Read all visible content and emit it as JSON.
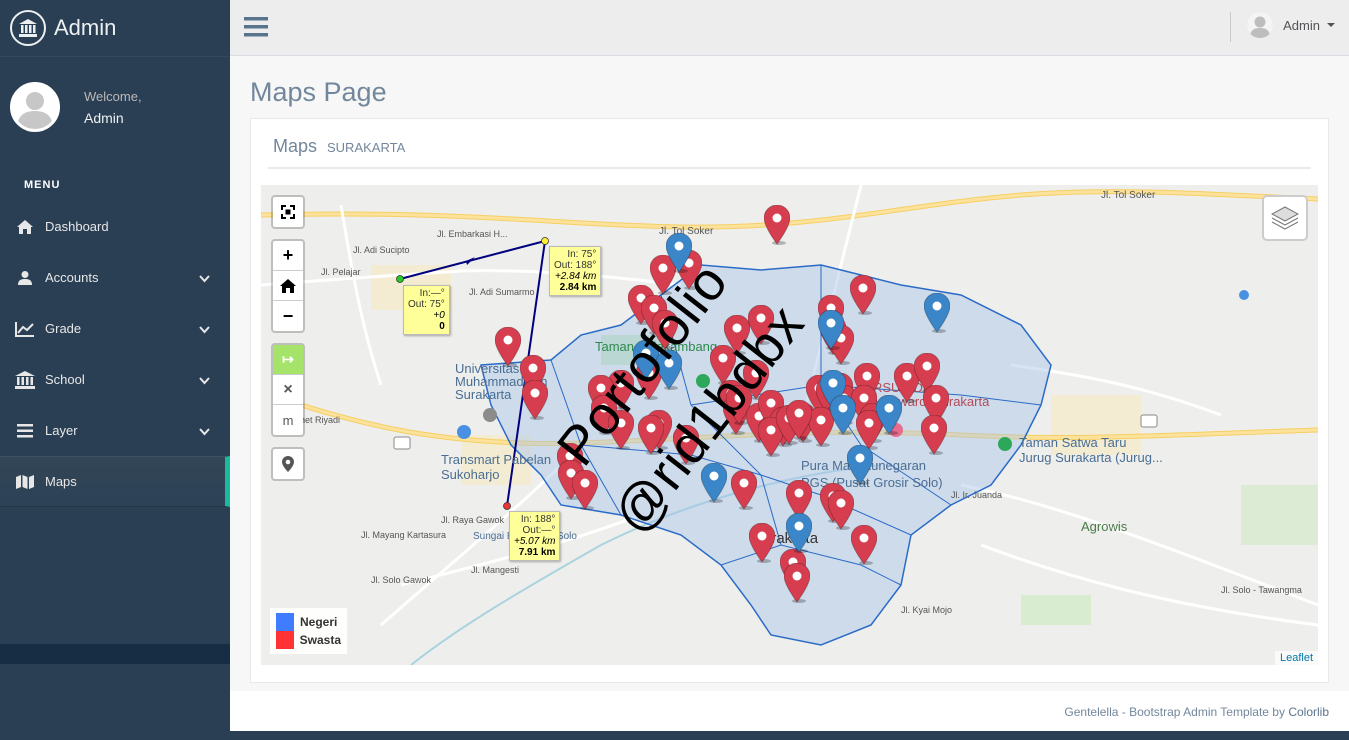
{
  "sidebar": {
    "brand": "Admin",
    "welcome": "Welcome,",
    "user": "Admin",
    "menu_title": "MENU",
    "items": [
      {
        "label": "Dashboard"
      },
      {
        "label": "Accounts"
      },
      {
        "label": "Grade"
      },
      {
        "label": "School"
      },
      {
        "label": "Layer"
      },
      {
        "label": "Maps"
      }
    ]
  },
  "topbar": {
    "user": "Admin"
  },
  "page": {
    "title": "Maps Page",
    "panel_title": "Maps",
    "panel_subtitle": "SURAKARTA"
  },
  "map": {
    "legend": [
      {
        "label": "Negeri",
        "color": "#3f7cff"
      },
      {
        "label": "Swasta",
        "color": "#ff3333"
      }
    ],
    "attribution": "Leaflet",
    "measure": {
      "start": {
        "in": "In:—°",
        "out": "Out: 75°",
        "seg": "+0",
        "total": "0"
      },
      "mid": {
        "in": "In: 75°",
        "out": "Out: 188°",
        "seg": "+2.84 km",
        "total": "2.84 km"
      },
      "end": {
        "in": "In: 188°",
        "out": "Out:—°",
        "seg": "+5.07 km",
        "total": "7.91 km"
      }
    },
    "places": {
      "univ": "Universitas Muhammadiyah Surakarta",
      "univ_l1": "Universitas",
      "univ_l2": "Muhammadiyah",
      "univ_l3": "Surakarta",
      "transmart_l1": "Transmart Pabelan",
      "transmart_l2": "Sukoharjo",
      "taman_l1": "Taman Satwa Taru",
      "taman_l2": "Jurug Surakarta (Jurug...",
      "rsud_l1": "RSUD Dr.",
      "rsud_l2": "Moewardi Surakarta",
      "agrowis": "Agrowis",
      "city": "Surakarta",
      "pura": "Pura Mangkunegaran",
      "pgs": "PGS (Pusat Grosir Solo)",
      "sungai": "Sungai Bengawan Solo",
      "taman_balekambang": "Taman Balekambang"
    },
    "roads": {
      "tol1": "Jl. Tol Soker",
      "tol2": "Jl. Tol Soker",
      "erlangga": "Jl. Adi Sumarmo",
      "embarkasi": "Jl. Embarkasi H...",
      "adisucipto": "Jl. Adi Sucipto",
      "slamet": "Jl. Slamet Riyadi",
      "raya_gawok": "Jl. Raya Gawok",
      "mayang": "Jl. Mayang Kartasura",
      "manggis": "Jl. Mangesti",
      "solo_gawok": "Jl. Solo Gawok",
      "kyai": "Jl. Kyai Mojo",
      "juanda": "Jl. Ir. Juanda",
      "solo_tawang": "Jl. Solo - Tawangma",
      "pelajar": "Jl. Pelajar"
    },
    "watermark_l1": "Portofolio",
    "watermark_l2": "@rid1bdbx"
  },
  "footer": {
    "text": "Gentelella - Bootstrap Admin Template by ",
    "link": "Colorlib"
  },
  "colors": {
    "sidebar": "#2a3f54",
    "accent": "#1abb9c",
    "marker_negeri": "#3a86c8",
    "marker_swasta": "#d63e4f"
  }
}
